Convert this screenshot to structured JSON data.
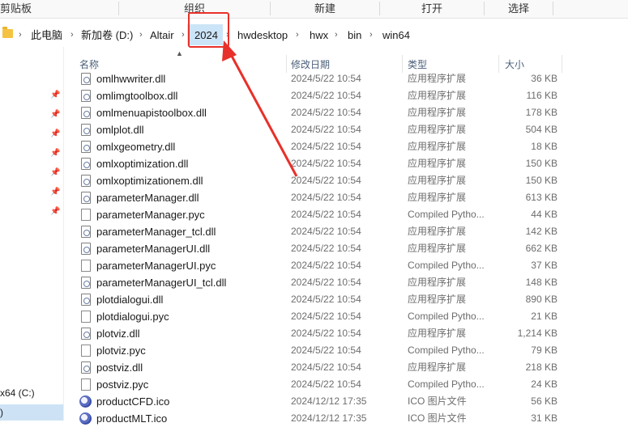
{
  "ribbon": {
    "groups": [
      "剪贴板",
      "组织",
      "新建",
      "打开",
      "选择"
    ]
  },
  "address": {
    "crumbs": [
      "此电脑",
      "新加卷 (D:)",
      "Altair",
      "2024",
      "hwdesktop",
      "hwx",
      "bin",
      "win64"
    ]
  },
  "nav": {
    "drive_label": "x64 (C:)",
    "drive2_label": ")"
  },
  "columns": {
    "name": "名称",
    "date": "修改日期",
    "type": "类型",
    "size": "大小"
  },
  "files": [
    {
      "name": "omlhwwriter.dll",
      "date": "2024/5/22 10:54",
      "type": "应用程序扩展",
      "size": "36 KB",
      "icon": "dll-icon"
    },
    {
      "name": "omlimgtoolbox.dll",
      "date": "2024/5/22 10:54",
      "type": "应用程序扩展",
      "size": "116 KB",
      "icon": "dll-icon"
    },
    {
      "name": "omlmenuapistoolbox.dll",
      "date": "2024/5/22 10:54",
      "type": "应用程序扩展",
      "size": "178 KB",
      "icon": "dll-icon"
    },
    {
      "name": "omlplot.dll",
      "date": "2024/5/22 10:54",
      "type": "应用程序扩展",
      "size": "504 KB",
      "icon": "dll-icon"
    },
    {
      "name": "omlxgeometry.dll",
      "date": "2024/5/22 10:54",
      "type": "应用程序扩展",
      "size": "18 KB",
      "icon": "dll-icon"
    },
    {
      "name": "omlxoptimization.dll",
      "date": "2024/5/22 10:54",
      "type": "应用程序扩展",
      "size": "150 KB",
      "icon": "dll-icon"
    },
    {
      "name": "omlxoptimizationem.dll",
      "date": "2024/5/22 10:54",
      "type": "应用程序扩展",
      "size": "150 KB",
      "icon": "dll-icon"
    },
    {
      "name": "parameterManager.dll",
      "date": "2024/5/22 10:54",
      "type": "应用程序扩展",
      "size": "613 KB",
      "icon": "dll-icon"
    },
    {
      "name": "parameterManager.pyc",
      "date": "2024/5/22 10:54",
      "type": "Compiled Pytho...",
      "size": "44 KB",
      "icon": "pyc-icon"
    },
    {
      "name": "parameterManager_tcl.dll",
      "date": "2024/5/22 10:54",
      "type": "应用程序扩展",
      "size": "142 KB",
      "icon": "dll-icon"
    },
    {
      "name": "parameterManagerUI.dll",
      "date": "2024/5/22 10:54",
      "type": "应用程序扩展",
      "size": "662 KB",
      "icon": "dll-icon"
    },
    {
      "name": "parameterManagerUI.pyc",
      "date": "2024/5/22 10:54",
      "type": "Compiled Pytho...",
      "size": "37 KB",
      "icon": "pyc-icon"
    },
    {
      "name": "parameterManagerUI_tcl.dll",
      "date": "2024/5/22 10:54",
      "type": "应用程序扩展",
      "size": "148 KB",
      "icon": "dll-icon"
    },
    {
      "name": "plotdialogui.dll",
      "date": "2024/5/22 10:54",
      "type": "应用程序扩展",
      "size": "890 KB",
      "icon": "dll-icon"
    },
    {
      "name": "plotdialogui.pyc",
      "date": "2024/5/22 10:54",
      "type": "Compiled Pytho...",
      "size": "21 KB",
      "icon": "pyc-icon"
    },
    {
      "name": "plotviz.dll",
      "date": "2024/5/22 10:54",
      "type": "应用程序扩展",
      "size": "1,214 KB",
      "icon": "dll-icon"
    },
    {
      "name": "plotviz.pyc",
      "date": "2024/5/22 10:54",
      "type": "Compiled Pytho...",
      "size": "79 KB",
      "icon": "pyc-icon"
    },
    {
      "name": "postviz.dll",
      "date": "2024/5/22 10:54",
      "type": "应用程序扩展",
      "size": "218 KB",
      "icon": "dll-icon"
    },
    {
      "name": "postviz.pyc",
      "date": "2024/5/22 10:54",
      "type": "Compiled Pytho...",
      "size": "24 KB",
      "icon": "pyc-icon"
    },
    {
      "name": "productCFD.ico",
      "date": "2024/12/12 17:35",
      "type": "ICO 图片文件",
      "size": "56 KB",
      "icon": "ico-icon"
    },
    {
      "name": "productMLT.ico",
      "date": "2024/12/12 17:35",
      "type": "ICO 图片文件",
      "size": "31 KB",
      "icon": "ico-icon"
    }
  ],
  "colors": {
    "highlight": "#cce4f7",
    "annotation": "#e8302a"
  }
}
